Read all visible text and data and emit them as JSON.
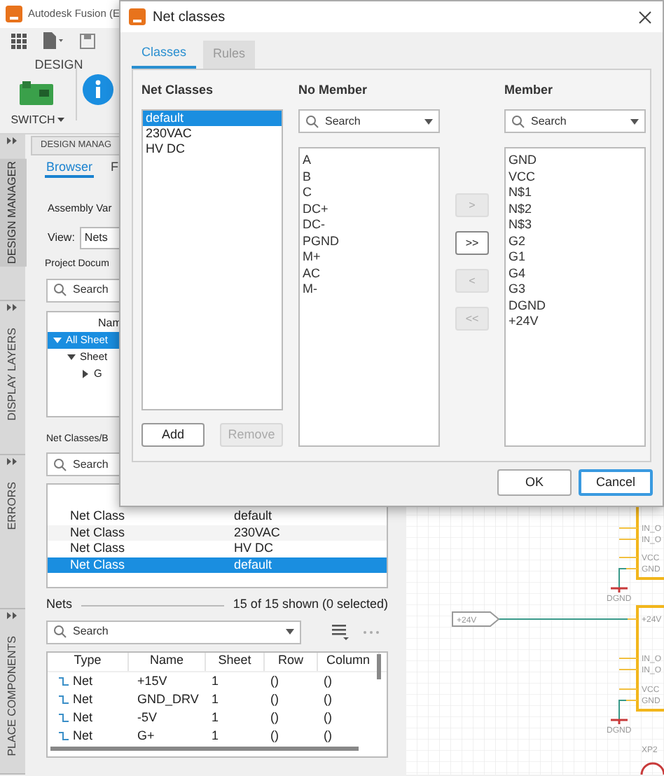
{
  "app": {
    "title": "Autodesk Fusion (E",
    "workspace": "DESIGN",
    "switch_label": "SWITCH"
  },
  "side_tabs": [
    {
      "label": "DESIGN MANAGER",
      "selected": true
    },
    {
      "label": "DISPLAY LAYERS",
      "selected": false
    },
    {
      "label": "ERRORS",
      "selected": false
    },
    {
      "label": "PLACE COMPONENTS",
      "selected": false
    }
  ],
  "panel": {
    "header": "DESIGN MANAG",
    "tabs": [
      {
        "label": "Browser",
        "selected": true
      },
      {
        "label": "F",
        "selected": false
      }
    ],
    "assembly_label": "Assembly Var",
    "view_label": "View:",
    "view_value": "Nets",
    "project_label": "Project Docum",
    "project_search": {
      "placeholder": "Search"
    },
    "tree": {
      "column": "Nam",
      "items": [
        {
          "label": "All Sheet",
          "selected": true,
          "expanded": true,
          "children": [
            {
              "label": "Sheet",
              "selected": false,
              "expanded": true,
              "children": [
                {
                  "label": "G",
                  "selected": false,
                  "expanded": false
                }
              ]
            }
          ]
        }
      ]
    },
    "net_classes": {
      "title": "Net Classes/B",
      "search": {
        "placeholder": "Search"
      },
      "rows": [
        {
          "type": "Net Class",
          "name": "default",
          "selected": false
        },
        {
          "type": "Net Class",
          "name": "230VAC",
          "selected": false
        },
        {
          "type": "Net Class",
          "name": "HV DC",
          "selected": false
        },
        {
          "type": "Net Class",
          "name": "default",
          "selected": true
        }
      ]
    },
    "nets": {
      "title": "Nets",
      "summary": "15 of 15 shown (0 selected)",
      "search": {
        "placeholder": "Search"
      },
      "columns": [
        "Type",
        "Name",
        "Sheet",
        "Row",
        "Column"
      ],
      "rows": [
        {
          "type": "Net",
          "name": "+15V",
          "sheet": "1",
          "row": "()",
          "column": "()"
        },
        {
          "type": "Net",
          "name": "GND_DRV",
          "sheet": "1",
          "row": "()",
          "column": "()"
        },
        {
          "type": "Net",
          "name": "-5V",
          "sheet": "1",
          "row": "()",
          "column": "()"
        },
        {
          "type": "Net",
          "name": "G+",
          "sheet": "1",
          "row": "()",
          "column": "()"
        }
      ]
    }
  },
  "schematic": {
    "parts": [
      {
        "pins": [
          "IN_O",
          "IN_O",
          "VCC",
          "GND"
        ],
        "ground": "DGND"
      },
      {
        "top_pin": "+24V",
        "pins": [
          "IN_O",
          "IN_O",
          "VCC",
          "GND"
        ],
        "ground": "DGND"
      }
    ],
    "net_label": "+24V",
    "designator": "XP2"
  },
  "dialog": {
    "title": "Net classes",
    "tabs": [
      {
        "label": "Classes",
        "selected": true
      },
      {
        "label": "Rules",
        "selected": false
      }
    ],
    "classes_label": "Net Classes",
    "classes": [
      {
        "label": "default",
        "selected": true
      },
      {
        "label": "230VAC",
        "selected": false
      },
      {
        "label": "HV DC",
        "selected": false
      }
    ],
    "add": {
      "label": "Add",
      "disabled": false
    },
    "remove": {
      "label": "Remove",
      "disabled": true
    },
    "no_member_label": "No Member",
    "no_member_search": {
      "placeholder": "Search"
    },
    "no_member": [
      "A",
      "B",
      "C",
      "DC+",
      "DC-",
      "PGND",
      "M+",
      "AC",
      "M-"
    ],
    "transfer_buttons": [
      {
        "label": ">",
        "disabled": true
      },
      {
        "label": ">>",
        "disabled": false
      },
      {
        "label": "<",
        "disabled": true
      },
      {
        "label": "<<",
        "disabled": true
      }
    ],
    "member_label": "Member",
    "member_search": {
      "placeholder": "Search"
    },
    "member": [
      "GND",
      "VCC",
      "N$1",
      "N$2",
      "N$3",
      "G2",
      "G1",
      "G4",
      "G3",
      "DGND",
      "+24V"
    ],
    "ok": {
      "label": "OK",
      "focused": false
    },
    "cancel": {
      "label": "Cancel",
      "focused": true
    }
  }
}
